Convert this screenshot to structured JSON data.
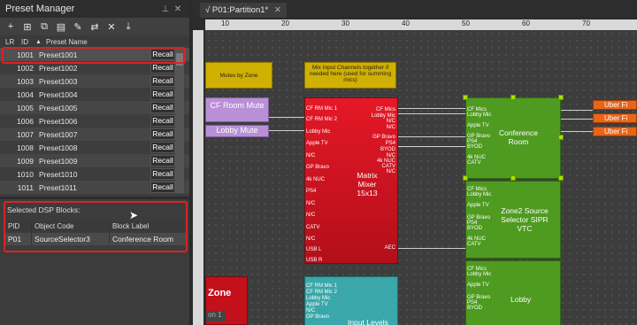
{
  "panel": {
    "title": "Preset Manager",
    "title_icons": [
      "pin-icon",
      "close-icon"
    ],
    "toolbar_icons": [
      "add-icon",
      "add-group-icon",
      "copy-icon",
      "paste-icon",
      "rename-icon",
      "merge-icon",
      "delete-icon",
      "export-icon"
    ],
    "columns": [
      "LR",
      "ID",
      "Preset Name"
    ],
    "recall_label": "Recall",
    "presets": [
      {
        "id": "1001",
        "name": "Preset1001"
      },
      {
        "id": "1002",
        "name": "Preset1002"
      },
      {
        "id": "1003",
        "name": "Preset1003"
      },
      {
        "id": "1004",
        "name": "Preset1004"
      },
      {
        "id": "1005",
        "name": "Preset1005"
      },
      {
        "id": "1006",
        "name": "Preset1006"
      },
      {
        "id": "1007",
        "name": "Preset1007"
      },
      {
        "id": "1008",
        "name": "Preset1008"
      },
      {
        "id": "1009",
        "name": "Preset1009"
      },
      {
        "id": "1010",
        "name": "Preset1010"
      },
      {
        "id": "1011",
        "name": "Preset1011"
      }
    ],
    "selected_label": "Selected DSP Blocks:",
    "dsp_columns": [
      "PID",
      "Object Code",
      "Block Label"
    ],
    "dsp_row": {
      "pid": "P01",
      "code": "SourceSelector3",
      "label": "Conference Room"
    }
  },
  "canvas": {
    "tab": "√ P01:Partition1*",
    "ruler_marks": [
      "10",
      "20",
      "30",
      "40",
      "50",
      "60",
      "70"
    ],
    "notes": {
      "mutes": "Mutes by Zone",
      "mix": "Mix Input Channels together if needed here (used for summing mics)"
    },
    "mute_blocks": [
      "CF Room Mute",
      "Lobby Mute"
    ],
    "matrix_title": "Matrix Mixer 15x13",
    "matrix_inputs": [
      "CF RM Mic 1",
      "CF RM Mic 2",
      "Lobby Mic",
      "Apple TV",
      "N/C",
      "GP Bravo",
      "4k NUC",
      "PS4",
      "N/C",
      "N/C",
      "CATV",
      "N/C",
      "USB L",
      "USB R"
    ],
    "matrix_outputs": [
      "CF Mics",
      "Lobby Mic",
      "N/C",
      "N/C",
      "GP Bravo",
      "PS4",
      "BYOD",
      "N/C",
      "4k NUC",
      "CATV",
      "N/C",
      "AEC"
    ],
    "input_levels_label": "Input Levels",
    "input_levels_rows": [
      "CF RM Mic 1",
      "CF RM Mic 2",
      "Lobby Mic",
      "Apple TV",
      "N/C",
      "GP Bravo"
    ],
    "zones": [
      {
        "title": "Conference Room",
        "inputs": [
          "CF Mics",
          "Lobby Mic",
          "Apple TV",
          "GP Bravo",
          "PS4",
          "BYOD",
          "4k NUC",
          "CATV"
        ]
      },
      {
        "title": "Zone2 Source Selector SIPR VTC",
        "inputs": [
          "CF Mics",
          "Lobby Mic",
          "Apple TV",
          "GP Bravo",
          "PS4",
          "BYOD",
          "4k NUC",
          "CATV"
        ]
      },
      {
        "title": "Lobby",
        "inputs": [
          "CF Mics",
          "Lobby Mic",
          "Apple TV",
          "GP Bravo",
          "PS4",
          "BYOD"
        ]
      }
    ],
    "outputs": [
      "Uber Fi",
      "Uber Fi",
      "Uber Fi"
    ],
    "partial_block": "Zone",
    "partial_sub": "on 1",
    "colors": {
      "matrix": "#d7101c",
      "zone": "#4f9a20",
      "mute": "#b98fd6",
      "note": "#d0b000",
      "output": "#e8651a",
      "levels": "#3aa7aa"
    }
  }
}
